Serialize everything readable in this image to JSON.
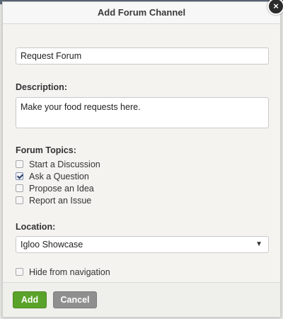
{
  "dialog": {
    "title": "Add Forum Channel",
    "close_symbol": "×"
  },
  "form": {
    "name_value": "Request Forum",
    "description_label": "Description:",
    "description_value": "Make your food requests here.",
    "topics_label": "Forum Topics:",
    "topics": [
      {
        "label": "Start a Discussion",
        "checked": false
      },
      {
        "label": "Ask a Question",
        "checked": true
      },
      {
        "label": "Propose an Idea",
        "checked": false
      },
      {
        "label": "Report an Issue",
        "checked": false
      }
    ],
    "location_label": "Location:",
    "location_value": "Igloo Showcase",
    "location_arrow": "▼",
    "hide_nav_label": "Hide from navigation",
    "hide_nav_checked": false
  },
  "footer": {
    "add_label": "Add",
    "cancel_label": "Cancel"
  },
  "colors": {
    "add_button": "#5aa32a",
    "cancel_button": "#8f8f8f",
    "dialog_bg": "#f4f3f0"
  }
}
